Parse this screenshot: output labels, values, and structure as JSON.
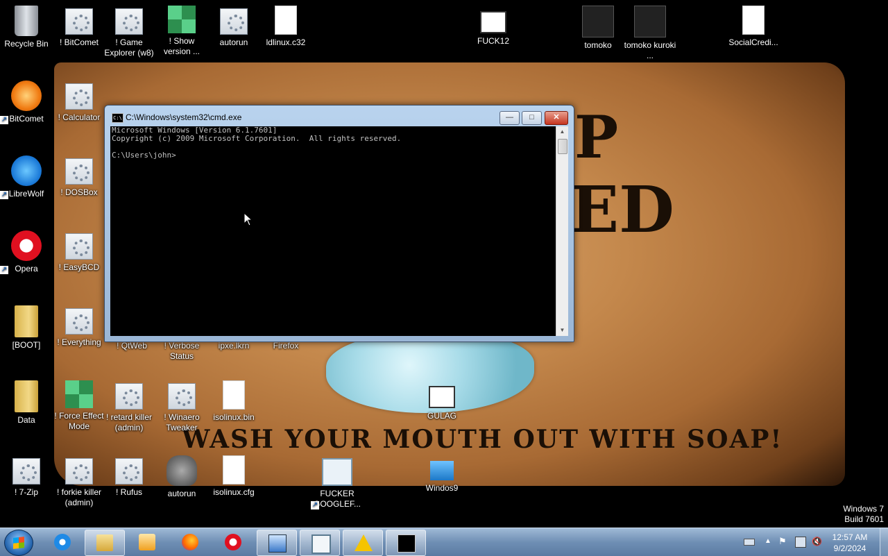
{
  "desktop": {
    "wallpaper_text": {
      "line_p": "P",
      "line_ed": "ED",
      "soap": "WASH YOUR MOUTH OUT WITH SOAP!"
    },
    "icons": [
      {
        "label": "Recycle Bin",
        "icon": "recycle-bin"
      },
      {
        "label": "! BitComet",
        "icon": "settings-gear"
      },
      {
        "label": "! Game Explorer (w8)",
        "icon": "settings-gear"
      },
      {
        "label": "! Show version ...",
        "icon": "registry-blocks"
      },
      {
        "label": "autorun",
        "icon": "settings-file"
      },
      {
        "label": "ldlinux.c32",
        "icon": "blank-file"
      },
      {
        "label": "FUCK12",
        "icon": "window"
      },
      {
        "label": "tomoko",
        "icon": "image"
      },
      {
        "label": "tomoko kuroki ...",
        "icon": "image"
      },
      {
        "label": "SocialCredi...",
        "icon": "blank-file"
      },
      {
        "label": "BitComet",
        "icon": "bitcomet"
      },
      {
        "label": "! Calculator",
        "icon": "settings-gear"
      },
      {
        "label": "LibreWolf",
        "icon": "librewolf"
      },
      {
        "label": "! DOSBox",
        "icon": "settings-gear"
      },
      {
        "label": "Opera",
        "icon": "opera"
      },
      {
        "label": "! EasyBCD",
        "icon": "settings-gear"
      },
      {
        "label": "[BOOT]",
        "icon": "folder"
      },
      {
        "label": "! Everything",
        "icon": "settings-gear"
      },
      {
        "label": "! QtWeb",
        "icon": "settings-gear"
      },
      {
        "label": "! Verbose Status",
        "icon": "settings-gear"
      },
      {
        "label": "ipxe.lkrn",
        "icon": "blank-file"
      },
      {
        "label": "Firefox",
        "icon": "firefox"
      },
      {
        "label": "Data",
        "icon": "folder"
      },
      {
        "label": "! Force Effect Mode",
        "icon": "registry-blocks"
      },
      {
        "label": "! retard killer (admin)",
        "icon": "settings-gear"
      },
      {
        "label": "! Winaero Tweaker",
        "icon": "settings-gear"
      },
      {
        "label": "isolinux.bin",
        "icon": "blank-file"
      },
      {
        "label": "GULAG",
        "icon": "window"
      },
      {
        "label": "! 7-Zip",
        "icon": "settings-gear"
      },
      {
        "label": "! forkie killer (admin)",
        "icon": "settings-gear"
      },
      {
        "label": "! Rufus",
        "icon": "settings-gear"
      },
      {
        "label": "autorun",
        "icon": "wolf"
      },
      {
        "label": "isolinux.cfg",
        "icon": "blank-file"
      },
      {
        "label": "FUCKER GOOGLEF...",
        "icon": "screenshot"
      },
      {
        "label": "Windos9",
        "icon": "windows-install"
      }
    ]
  },
  "cmd": {
    "title": "C:\\Windows\\system32\\cmd.exe",
    "icon_text": "C:\\",
    "lines": "Microsoft Windows [Version 6.1.7601]\nCopyright (c) 2009 Microsoft Corporation.  All rights reserved.\n\nC:\\Users\\john>",
    "minimize": "—",
    "maximize": "□",
    "close": "✕"
  },
  "watermark": {
    "line1": "Windows 7",
    "line2": "Build 7601"
  },
  "taskbar": {
    "pinned": [
      {
        "name": "internet-explorer",
        "active": false
      },
      {
        "name": "windows-explorer",
        "active": true
      },
      {
        "name": "media-player",
        "active": false
      },
      {
        "name": "firefox",
        "active": false
      },
      {
        "name": "opera",
        "active": false
      },
      {
        "name": "network-computer",
        "active": true
      },
      {
        "name": "screenshot-tool",
        "active": true
      },
      {
        "name": "warning",
        "active": true
      },
      {
        "name": "cmd",
        "active": true
      }
    ],
    "clock_time": "12:57 AM",
    "clock_date": "9/2/2024"
  },
  "colors": {
    "console_text": "#c0c0c0",
    "console_bg": "#000000",
    "close_button": "#c63520"
  }
}
